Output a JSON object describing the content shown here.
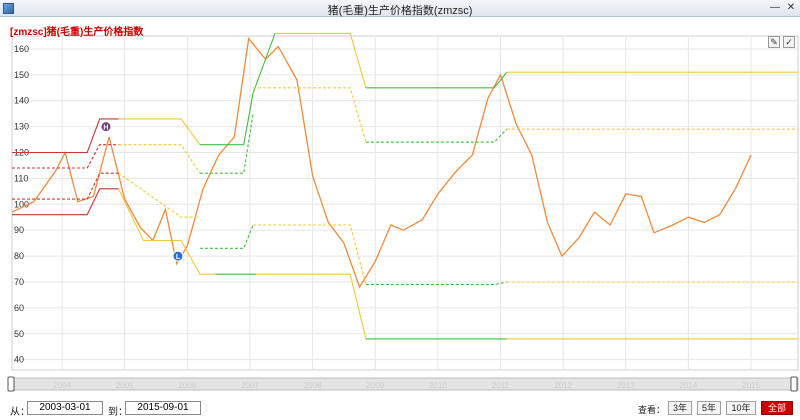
{
  "window": {
    "title": "猪(毛重)生产价格指数(zmzsc)"
  },
  "chart_title": "[zmzsc]猪(毛重)生产价格指数",
  "toolbar": {
    "edit_icon": "pencil-icon",
    "clear_icon": "check-icon"
  },
  "range": {
    "from_label": "从：",
    "from_value": "2003-03-01",
    "to_label": "到：",
    "to_value": "2015-09-01"
  },
  "view": {
    "label": "查看：",
    "buttons": [
      {
        "label": "3年"
      },
      {
        "label": "5年"
      },
      {
        "label": "10年"
      },
      {
        "label": "全部"
      }
    ],
    "active": "全部"
  },
  "markers": [
    {
      "label": "H"
    },
    {
      "label": "L"
    }
  ],
  "chart_data": {
    "type": "line",
    "y_ticks": [
      40,
      50,
      60,
      70,
      80,
      90,
      100,
      110,
      120,
      130,
      140,
      150,
      160
    ],
    "ylim": [
      36,
      165
    ],
    "x_tick_labels": [
      "2004",
      "2005",
      "2006",
      "2007",
      "2008",
      "2009",
      "2010",
      "2011",
      "2012",
      "2013",
      "2014",
      "2015"
    ],
    "xlim": [
      2003.2,
      2015.75
    ],
    "grid": true,
    "colors": {
      "index": "#f08a3c",
      "red": "#cc3333",
      "yellow": "#f2c83a",
      "green": "#44bb44"
    },
    "series": [
      {
        "role": "index",
        "dash": false,
        "points": [
          [
            2003.2,
            97
          ],
          [
            2003.55,
            101
          ],
          [
            2003.9,
            113
          ],
          [
            2004.05,
            120
          ],
          [
            2004.25,
            101
          ],
          [
            2004.5,
            103
          ],
          [
            2004.75,
            126
          ],
          [
            2005.0,
            102
          ],
          [
            2005.25,
            91
          ],
          [
            2005.45,
            86
          ],
          [
            2005.65,
            98
          ],
          [
            2005.83,
            77
          ],
          [
            2006.0,
            84
          ],
          [
            2006.25,
            106
          ],
          [
            2006.5,
            119
          ],
          [
            2006.75,
            126
          ],
          [
            2006.98,
            164
          ],
          [
            2007.25,
            156
          ],
          [
            2007.45,
            161
          ],
          [
            2007.75,
            148
          ],
          [
            2008.0,
            111
          ],
          [
            2008.25,
            93
          ],
          [
            2008.5,
            85
          ],
          [
            2008.75,
            68
          ],
          [
            2009.0,
            78
          ],
          [
            2009.25,
            92
          ],
          [
            2009.45,
            90
          ],
          [
            2009.75,
            94
          ],
          [
            2010.0,
            104
          ],
          [
            2010.3,
            113
          ],
          [
            2010.55,
            119
          ],
          [
            2010.8,
            141
          ],
          [
            2011.0,
            150
          ],
          [
            2011.25,
            131
          ],
          [
            2011.5,
            119
          ],
          [
            2011.75,
            93
          ],
          [
            2011.98,
            80
          ],
          [
            2012.25,
            87
          ],
          [
            2012.5,
            97
          ],
          [
            2012.75,
            92
          ],
          [
            2013.0,
            104
          ],
          [
            2013.25,
            103
          ],
          [
            2013.45,
            89
          ],
          [
            2013.75,
            92
          ],
          [
            2014.0,
            95
          ],
          [
            2014.25,
            93
          ],
          [
            2014.5,
            96
          ],
          [
            2014.75,
            106
          ],
          [
            2015.0,
            119
          ]
        ]
      },
      {
        "role": "red",
        "dash": false,
        "points": [
          [
            2003.2,
            120
          ],
          [
            2004.4,
            120
          ],
          [
            2004.6,
            133
          ],
          [
            2004.9,
            133
          ]
        ]
      },
      {
        "role": "red",
        "dash": true,
        "points": [
          [
            2003.2,
            114
          ],
          [
            2004.4,
            114
          ],
          [
            2004.6,
            123
          ],
          [
            2004.9,
            123
          ]
        ]
      },
      {
        "role": "red",
        "dash": true,
        "points": [
          [
            2003.2,
            102
          ],
          [
            2004.4,
            102
          ],
          [
            2004.6,
            112
          ],
          [
            2004.9,
            112
          ]
        ]
      },
      {
        "role": "red",
        "dash": false,
        "points": [
          [
            2003.2,
            96
          ],
          [
            2004.4,
            96
          ],
          [
            2004.6,
            106
          ],
          [
            2004.9,
            106
          ]
        ]
      },
      {
        "role": "yellow",
        "dash": false,
        "points": [
          [
            2004.9,
            133
          ],
          [
            2005.9,
            133
          ],
          [
            2006.2,
            123
          ]
        ]
      },
      {
        "role": "yellow",
        "dash": true,
        "points": [
          [
            2004.9,
            123
          ],
          [
            2005.9,
            123
          ],
          [
            2006.2,
            112
          ]
        ]
      },
      {
        "role": "yellow",
        "dash": true,
        "points": [
          [
            2004.9,
            112
          ],
          [
            2005.9,
            95
          ],
          [
            2006.2,
            95
          ]
        ]
      },
      {
        "role": "yellow",
        "dash": false,
        "points": [
          [
            2004.9,
            106
          ],
          [
            2005.3,
            86
          ],
          [
            2005.9,
            86
          ],
          [
            2006.2,
            73
          ],
          [
            2006.45,
            73
          ]
        ]
      },
      {
        "role": "green",
        "dash": false,
        "points": [
          [
            2006.2,
            123
          ],
          [
            2006.9,
            123
          ],
          [
            2007.05,
            143
          ],
          [
            2007.4,
            166
          ]
        ]
      },
      {
        "role": "green",
        "dash": true,
        "points": [
          [
            2006.2,
            112
          ],
          [
            2006.9,
            112
          ],
          [
            2007.05,
            135
          ]
        ]
      },
      {
        "role": "green",
        "dash": true,
        "points": [
          [
            2006.2,
            83
          ],
          [
            2006.9,
            83
          ],
          [
            2007.05,
            92
          ]
        ]
      },
      {
        "role": "green",
        "dash": false,
        "points": [
          [
            2006.45,
            73
          ],
          [
            2007.1,
            73
          ]
        ]
      },
      {
        "role": "yellow",
        "dash": false,
        "points": [
          [
            2007.4,
            166
          ],
          [
            2008.6,
            166
          ],
          [
            2008.85,
            145
          ]
        ]
      },
      {
        "role": "yellow",
        "dash": true,
        "points": [
          [
            2007.05,
            145
          ],
          [
            2008.6,
            145
          ],
          [
            2008.85,
            124
          ]
        ]
      },
      {
        "role": "yellow",
        "dash": true,
        "points": [
          [
            2007.05,
            92
          ],
          [
            2008.6,
            92
          ],
          [
            2008.85,
            69
          ]
        ]
      },
      {
        "role": "yellow",
        "dash": false,
        "points": [
          [
            2007.1,
            73
          ],
          [
            2008.6,
            73
          ],
          [
            2008.85,
            48
          ]
        ]
      },
      {
        "role": "green",
        "dash": false,
        "points": [
          [
            2008.85,
            145
          ],
          [
            2010.9,
            145
          ],
          [
            2011.1,
            151
          ]
        ]
      },
      {
        "role": "green",
        "dash": true,
        "points": [
          [
            2008.85,
            124
          ],
          [
            2010.9,
            124
          ],
          [
            2011.1,
            129
          ]
        ]
      },
      {
        "role": "green",
        "dash": true,
        "points": [
          [
            2008.85,
            69
          ],
          [
            2010.9,
            69
          ],
          [
            2011.1,
            70
          ]
        ]
      },
      {
        "role": "green",
        "dash": false,
        "points": [
          [
            2008.85,
            48
          ],
          [
            2011.1,
            48
          ]
        ]
      },
      {
        "role": "yellow",
        "dash": false,
        "points": [
          [
            2011.1,
            151
          ],
          [
            2015.75,
            151
          ]
        ]
      },
      {
        "role": "yellow",
        "dash": true,
        "points": [
          [
            2011.1,
            129
          ],
          [
            2015.75,
            129
          ]
        ]
      },
      {
        "role": "yellow",
        "dash": true,
        "points": [
          [
            2011.1,
            70
          ],
          [
            2015.75,
            70
          ]
        ]
      },
      {
        "role": "yellow",
        "dash": false,
        "points": [
          [
            2011.1,
            48
          ],
          [
            2015.75,
            48
          ]
        ]
      }
    ],
    "marker_points": [
      {
        "x": 2004.7,
        "y": 130,
        "color": "#6b3f82"
      },
      {
        "x": 2005.85,
        "y": 80,
        "color": "#2d6fd6"
      }
    ]
  }
}
